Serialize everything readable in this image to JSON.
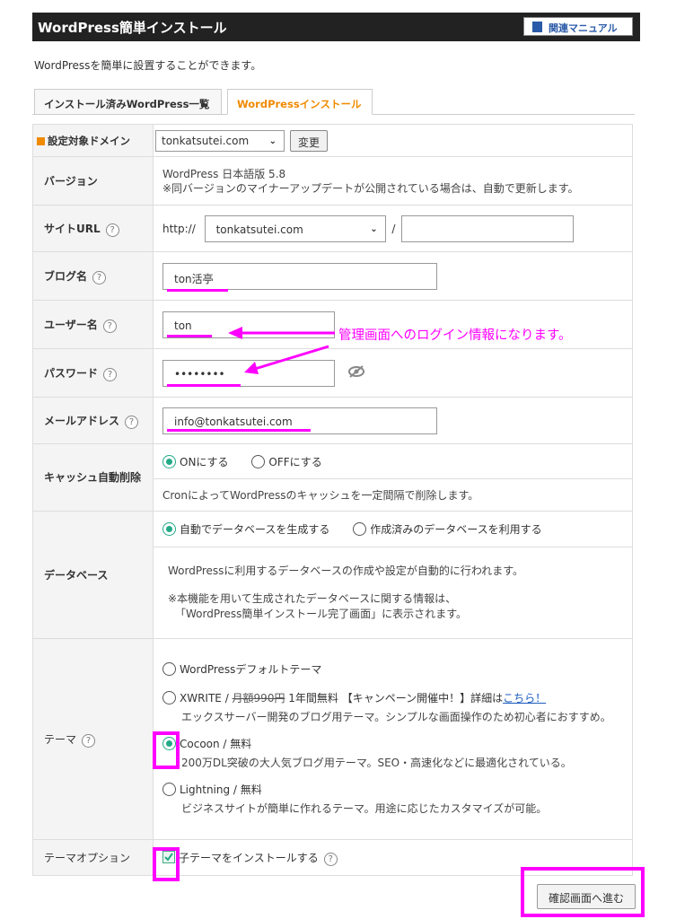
{
  "header": {
    "title": "WordPress簡単インストール",
    "manual_label": "関連マニュアル"
  },
  "intro": "WordPressを簡単に設置することができます。",
  "tabs": [
    {
      "label": "インストール済みWordPress一覧"
    },
    {
      "label": "WordPressインストール"
    }
  ],
  "domain": {
    "label": "設定対象ドメイン",
    "value": "tonkatsutei.com",
    "button": "変更"
  },
  "version": {
    "label": "バージョン",
    "line1": "WordPress 日本語版 5.8",
    "line2": "※同バージョンのマイナーアップデートが公開されている場合は、自動で更新します。"
  },
  "site_url": {
    "label": "サイトURL",
    "scheme": "http://",
    "domain": "tonkatsutei.com",
    "slash": "/",
    "path": ""
  },
  "blog_name": {
    "label": "ブログ名",
    "value": "ton活亭"
  },
  "username": {
    "label": "ユーザー名",
    "value": "ton"
  },
  "password": {
    "label": "パスワード",
    "value": "••••••••"
  },
  "email": {
    "label": "メールアドレス",
    "value": "info@tonkatsutei.com"
  },
  "cache": {
    "label": "キャッシュ自動削除",
    "on": "ONにする",
    "off": "OFFにする",
    "desc": "CronによってWordPressのキャッシュを一定間隔で削除します。"
  },
  "database": {
    "label": "データベース",
    "opt_auto": "自動でデータベースを生成する",
    "opt_existing": "作成済みのデータベースを利用する",
    "desc1": "WordPressに利用するデータベースの作成や設定が自動的に行われます。",
    "desc2": "※本機能を用いて生成されたデータベースに関する情報は、",
    "desc3": "「WordPress簡単インストール完了画面」に表示されます。"
  },
  "theme": {
    "label": "テーマ",
    "default": "WordPressデフォルトテーマ",
    "xwrite_name": "XWRITE / ",
    "xwrite_old_price": "月額990円",
    "xwrite_promo": " 1年間無料 【キャンペーン開催中！】詳細は",
    "xwrite_link": "こちら！",
    "xwrite_desc": "エックスサーバー開発のブログ用テーマ。シンプルな画面操作のため初心者におすすめ。",
    "cocoon_name": "Cocoon / 無料",
    "cocoon_desc": "200万DL突破の大人気ブログ用テーマ。SEO・高速化などに最適化されている。",
    "lightning_name": "Lightning / 無料",
    "lightning_desc": "ビジネスサイトが簡単に作れるテーマ。用途に応じたカスタマイズが可能。"
  },
  "theme_option": {
    "label": "テーマオプション",
    "child": "子テーマをインストールする"
  },
  "annotation": "管理画面へのログイン情報になります。",
  "submit_label": "確認画面へ進む",
  "colors": {
    "accent": "#ff00ff",
    "tab_active": "#f08a00",
    "radio_on": "#22aa88"
  }
}
